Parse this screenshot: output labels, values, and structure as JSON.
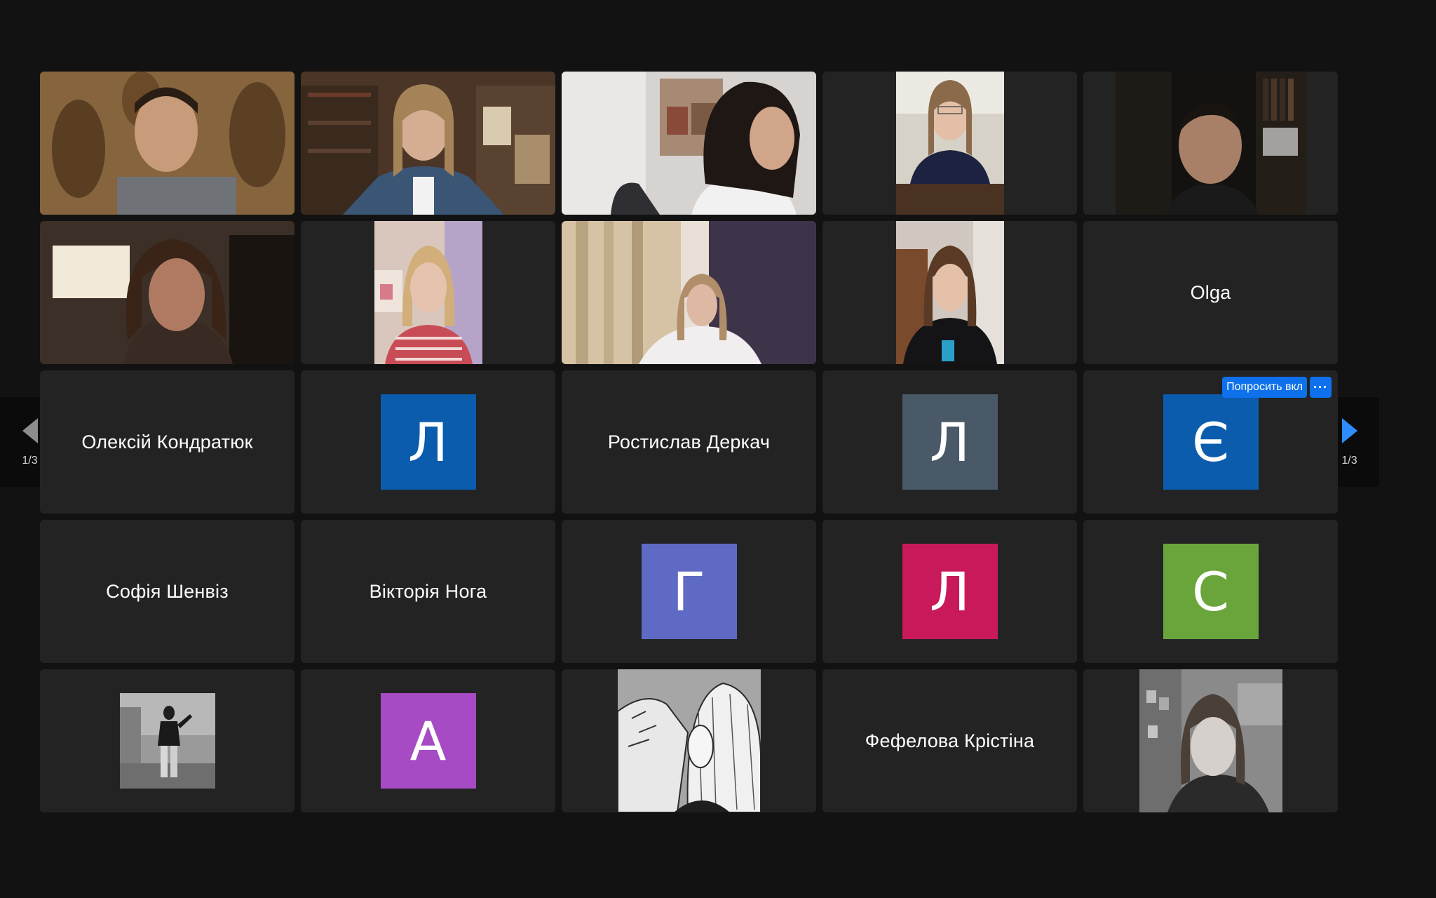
{
  "pager": {
    "left_label": "1/3",
    "right_label": "1/3",
    "left_arrow_color": "#8c8c8c",
    "right_arrow_color": "#2d8cff"
  },
  "participants": [
    {
      "kind": "video",
      "active": true
    },
    {
      "kind": "video"
    },
    {
      "kind": "video"
    },
    {
      "kind": "video"
    },
    {
      "kind": "video"
    },
    {
      "kind": "video"
    },
    {
      "kind": "video"
    },
    {
      "kind": "video"
    },
    {
      "kind": "video"
    },
    {
      "kind": "name",
      "name": "Olga"
    },
    {
      "kind": "name",
      "name": "Олексій Кондратюк"
    },
    {
      "kind": "avatar",
      "initial": "Л",
      "color": "#0b5cad"
    },
    {
      "kind": "name",
      "name": "Ростислав Деркач"
    },
    {
      "kind": "avatar",
      "initial": "Л",
      "color": "#4a5968"
    },
    {
      "kind": "avatar",
      "initial": "Є",
      "color": "#0b5cad",
      "ask_label": "Попросить вкл",
      "more_label": "···"
    },
    {
      "kind": "name",
      "name": "Софія Шенвіз"
    },
    {
      "kind": "name",
      "name": "Вікторія Нога"
    },
    {
      "kind": "avatar",
      "initial": "Г",
      "color": "#5f6ac4"
    },
    {
      "kind": "avatar",
      "initial": "Л",
      "color": "#c81a5b"
    },
    {
      "kind": "avatar",
      "initial": "С",
      "color": "#6aa53c"
    },
    {
      "kind": "profile-pic"
    },
    {
      "kind": "avatar",
      "initial": "А",
      "color": "#a64bc4"
    },
    {
      "kind": "profile-pic"
    },
    {
      "kind": "name",
      "name": "Фефелова Крістіна"
    },
    {
      "kind": "profile-pic"
    }
  ]
}
